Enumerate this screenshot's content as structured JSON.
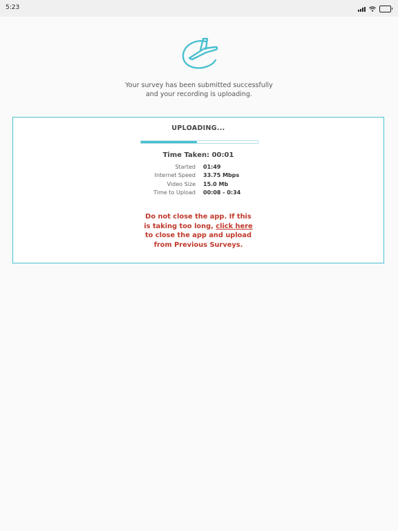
{
  "status_bar": {
    "time": "5:23",
    "icons": [
      "cellular-signal-icon",
      "wifi-icon",
      "battery-icon"
    ]
  },
  "logo": {
    "icon": "plane-swoosh-logo",
    "color": "#49c0cf"
  },
  "message": {
    "line1": "Your survey has been submitted successfully",
    "line2": "and your recording is uploading."
  },
  "upload_card": {
    "title": "UPLOADING...",
    "progress_percent": 48,
    "time_taken": "Time Taken: 00:01",
    "stats": [
      {
        "label": "Started",
        "value": "01:49"
      },
      {
        "label": "Internet Speed",
        "value": "33.75 Mbps"
      },
      {
        "label": "Video Size",
        "value": "15.0 Mb"
      },
      {
        "label": "Time to Upload",
        "value": "00:08 - 0:34"
      }
    ],
    "warning": {
      "line1": "Do not close the app. If this",
      "line2_prefix": "is taking too long, ",
      "link": "click here",
      "line3": "to close the app and upload",
      "line4": "from Previous Surveys."
    }
  },
  "colors": {
    "accent": "#49c0cf",
    "warning": "#c0392b",
    "background": "#fafafa"
  }
}
